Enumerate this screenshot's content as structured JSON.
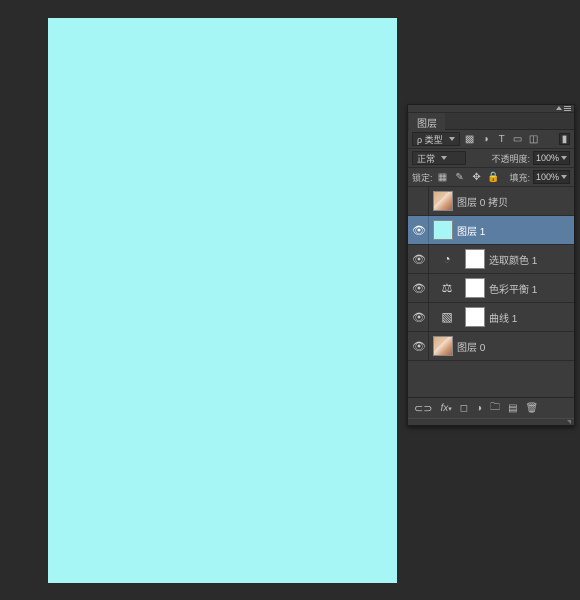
{
  "canvas": {
    "color": "#a7f6f6"
  },
  "panel": {
    "tab": "图层",
    "filter": {
      "label": "ρ 类型"
    },
    "blend": {
      "mode": "正常",
      "opacity_label": "不透明度:",
      "opacity_value": "100%"
    },
    "lock": {
      "label": "锁定:",
      "fill_label": "填充:",
      "fill_value": "100%"
    },
    "layers": [
      {
        "name": "图层 0 拷贝",
        "visible": false,
        "thumb": "portrait",
        "selected": false
      },
      {
        "name": "图层 1",
        "visible": true,
        "thumb": "cyan",
        "selected": true
      },
      {
        "name": "选取颜色 1",
        "visible": true,
        "adjustment": "selective-color",
        "selected": false
      },
      {
        "name": "色彩平衡 1",
        "visible": true,
        "adjustment": "color-balance",
        "selected": false
      },
      {
        "name": "曲线 1",
        "visible": true,
        "adjustment": "curves",
        "selected": false
      },
      {
        "name": "图层 0",
        "visible": true,
        "thumb": "portrait",
        "selected": false
      }
    ]
  }
}
